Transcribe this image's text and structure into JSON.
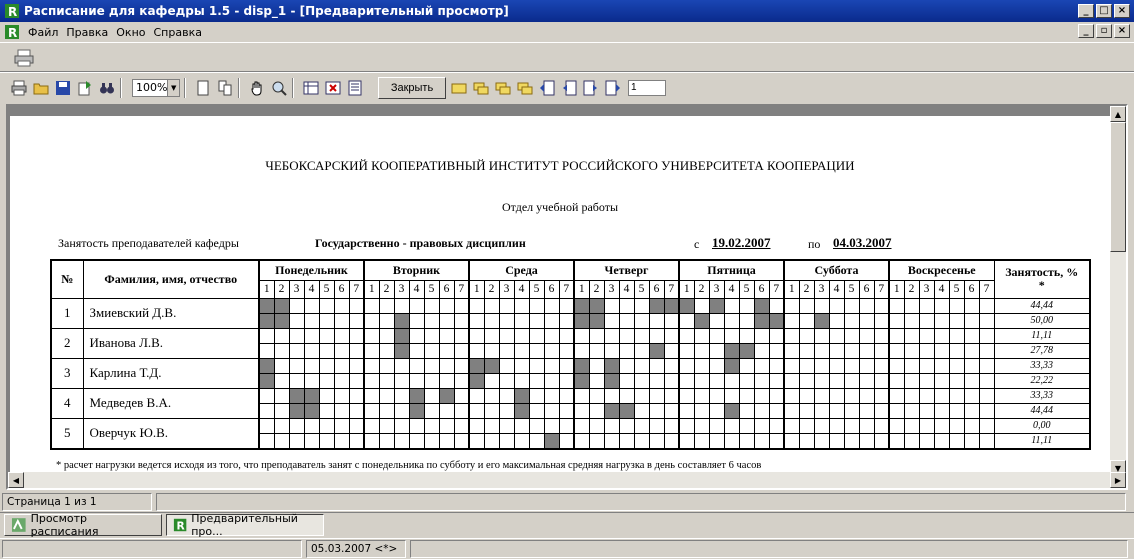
{
  "window": {
    "title": "Расписание для кафедры 1.5 - disp_1 - [Предварительный просмотр]"
  },
  "menu": [
    "Файл",
    "Правка",
    "Окно",
    "Справка"
  ],
  "toolbar": {
    "zoom": "100%",
    "close_label": "Закрыть",
    "page_value": "1"
  },
  "report": {
    "institute": "ЧЕБОКСАРСКИЙ КООПЕРАТИВНЫЙ ИНСТИТУТ РОССИЙСКОГО УНИВЕРСИТЕТА КООПЕРАЦИИ",
    "department_office": "Отдел учебной работы",
    "workload_label": "Занятость преподавателей кафедры",
    "department": "Государственно - правовых дисциплин",
    "from_label": "с",
    "from_date": "19.02.2007",
    "to_label": "по",
    "to_date": "04.03.2007",
    "col_num": "№",
    "col_name": "Фамилия, имя, отчество",
    "days": [
      "Понедельник",
      "Вторник",
      "Среда",
      "Четверг",
      "Пятница",
      "Суббота",
      "Воскресенье"
    ],
    "col_pct": "Занятость, %",
    "pct_star": "*",
    "footnote": "* расчет нагрузки ведется исходя из того, что преподаватель занят с понедельника по субботу и его максимальная средняя нагрузка в день составляет 6 часов",
    "teachers": [
      {
        "num": "1",
        "name": "Змиевский Д.В.",
        "pct": [
          "44,44",
          "50,00"
        ],
        "week1": [
          [
            1,
            2
          ],
          [],
          [],
          [
            1,
            2,
            6,
            7
          ],
          [
            1,
            3,
            6
          ],
          [],
          []
        ],
        "week2": [
          [
            1,
            2
          ],
          [
            3
          ],
          [],
          [
            1,
            2
          ],
          [
            2,
            6,
            7
          ],
          [
            3
          ],
          []
        ]
      },
      {
        "num": "2",
        "name": "Иванова Л.В.",
        "pct": [
          "11,11",
          "27,78"
        ],
        "week1": [
          [],
          [
            3
          ],
          [],
          [],
          [],
          [],
          []
        ],
        "week2": [
          [],
          [
            3
          ],
          [],
          [
            6
          ],
          [
            4,
            5
          ],
          [],
          []
        ]
      },
      {
        "num": "3",
        "name": "Карлина Т.Д.",
        "pct": [
          "33,33",
          "22,22"
        ],
        "week1": [
          [
            1
          ],
          [],
          [
            1,
            2
          ],
          [
            1,
            3
          ],
          [
            4
          ],
          [],
          []
        ],
        "week2": [
          [
            1
          ],
          [],
          [
            1
          ],
          [
            1,
            3
          ],
          [],
          [],
          []
        ]
      },
      {
        "num": "4",
        "name": "Медведев В.А.",
        "pct": [
          "33,33",
          "44,44"
        ],
        "week1": [
          [
            3,
            4
          ],
          [
            4,
            6
          ],
          [
            4
          ],
          [],
          [],
          [],
          []
        ],
        "week2": [
          [
            3,
            4
          ],
          [
            4
          ],
          [
            4
          ],
          [
            3,
            4
          ],
          [
            4
          ],
          [],
          []
        ]
      },
      {
        "num": "5",
        "name": "Оверчук Ю.В.",
        "pct": [
          "0,00",
          "11,11"
        ],
        "week1": [
          [],
          [],
          [],
          [],
          [],
          [],
          []
        ],
        "week2": [
          [],
          [],
          [
            6
          ],
          [],
          [],
          [],
          []
        ]
      }
    ]
  },
  "status": {
    "page": "Страница 1 из 1"
  },
  "tasks": [
    "Просмотр расписания",
    "Предварительный про..."
  ],
  "bottom": {
    "date": "05.03.2007 <*>"
  },
  "colors": {
    "filled": "#808080",
    "title_bar": "#0a2a8c"
  }
}
